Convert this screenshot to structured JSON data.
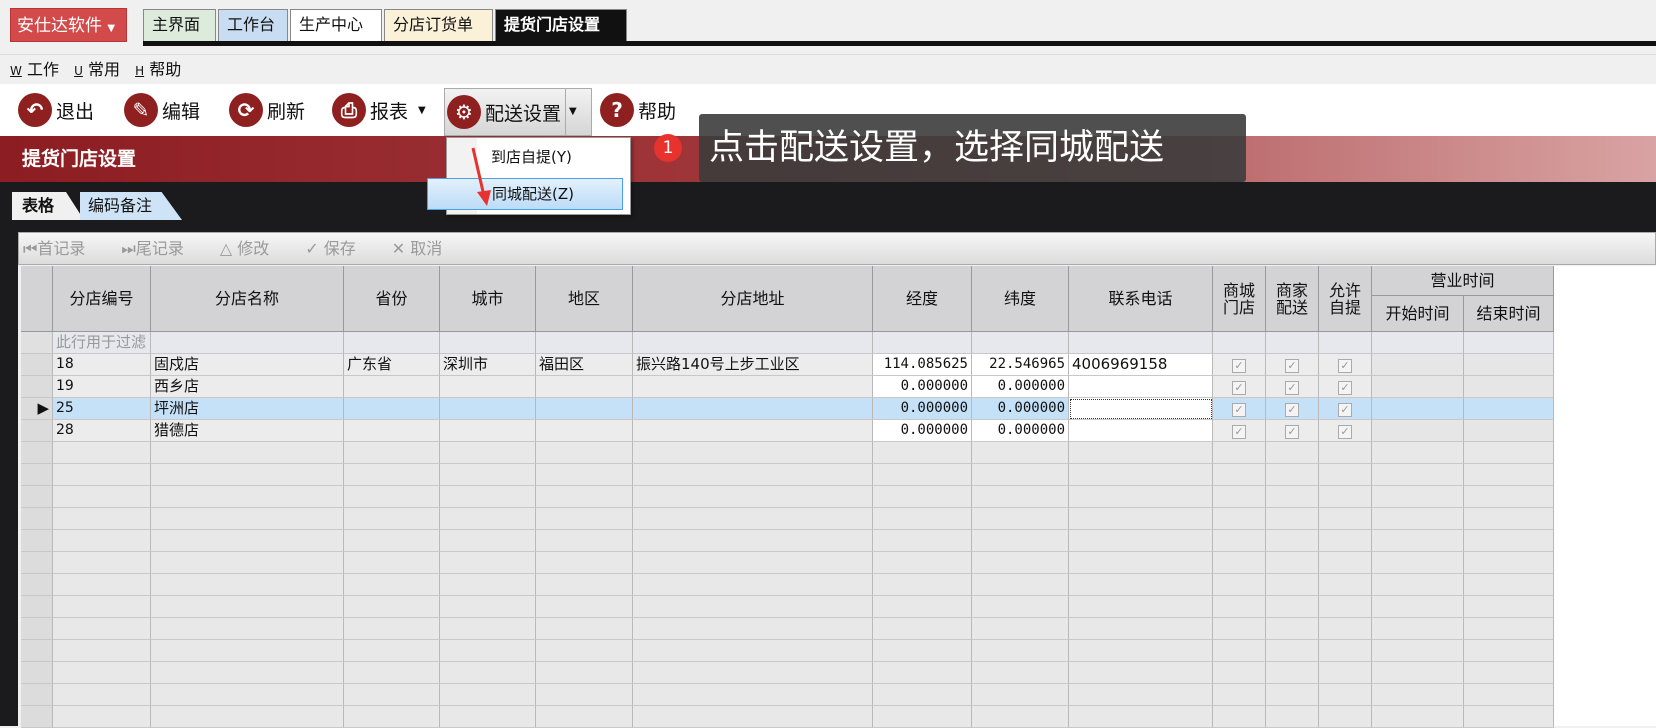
{
  "app": {
    "brand": "安仕达软件",
    "tabs": [
      "主界面",
      "工作台",
      "生产中心",
      "分店订货单",
      "提货门店设置"
    ]
  },
  "menu": [
    {
      "key": "W",
      "label": "工作"
    },
    {
      "key": "U",
      "label": "常用"
    },
    {
      "key": "H",
      "label": "帮助"
    }
  ],
  "toolbar": {
    "exit": "退出",
    "edit": "编辑",
    "refresh": "刷新",
    "report": "报表",
    "delivery": "配送设置",
    "help": "帮助"
  },
  "popup": {
    "items": [
      "到店自提(Y)",
      "同城配送(Z)"
    ]
  },
  "tooltip": {
    "badge": "1",
    "text": "点击配送设置，选择同城配送"
  },
  "title": "提货门店设置",
  "subtabs": [
    "表格",
    "编码备注"
  ],
  "nav": [
    "首记录",
    "尾记录",
    "修改",
    "保存",
    "取消"
  ],
  "grid": {
    "headers": [
      "分店编号",
      "分店名称",
      "省份",
      "城市",
      "地区",
      "分店地址",
      "经度",
      "纬度",
      "联系电话",
      "商城门店",
      "商家配送",
      "允许自提"
    ],
    "group_header": "营业时间",
    "sub_headers": [
      "开始时间",
      "结束时间"
    ],
    "filter_hint": "此行用于过滤",
    "rows": [
      {
        "id": "18",
        "name": "固戍店",
        "province": "广东省",
        "city": "深圳市",
        "district": "福田区",
        "address": "振兴路140号上步工业区",
        "lng": "114.085625",
        "lat": "22.546965",
        "phone": "4006969158",
        "mall": true,
        "merchant": true,
        "pickup": true
      },
      {
        "id": "19",
        "name": "西乡店",
        "province": "",
        "city": "",
        "district": "",
        "address": "",
        "lng": "0.000000",
        "lat": "0.000000",
        "phone": "",
        "mall": true,
        "merchant": true,
        "pickup": true
      },
      {
        "id": "25",
        "name": "坪洲店",
        "province": "",
        "city": "",
        "district": "",
        "address": "",
        "lng": "0.000000",
        "lat": "0.000000",
        "phone": "",
        "mall": true,
        "merchant": true,
        "pickup": true,
        "selected": true
      },
      {
        "id": "28",
        "name": "猎德店",
        "province": "",
        "city": "",
        "district": "",
        "address": "",
        "lng": "0.000000",
        "lat": "0.000000",
        "phone": "",
        "mall": true,
        "merchant": true,
        "pickup": true
      }
    ]
  }
}
